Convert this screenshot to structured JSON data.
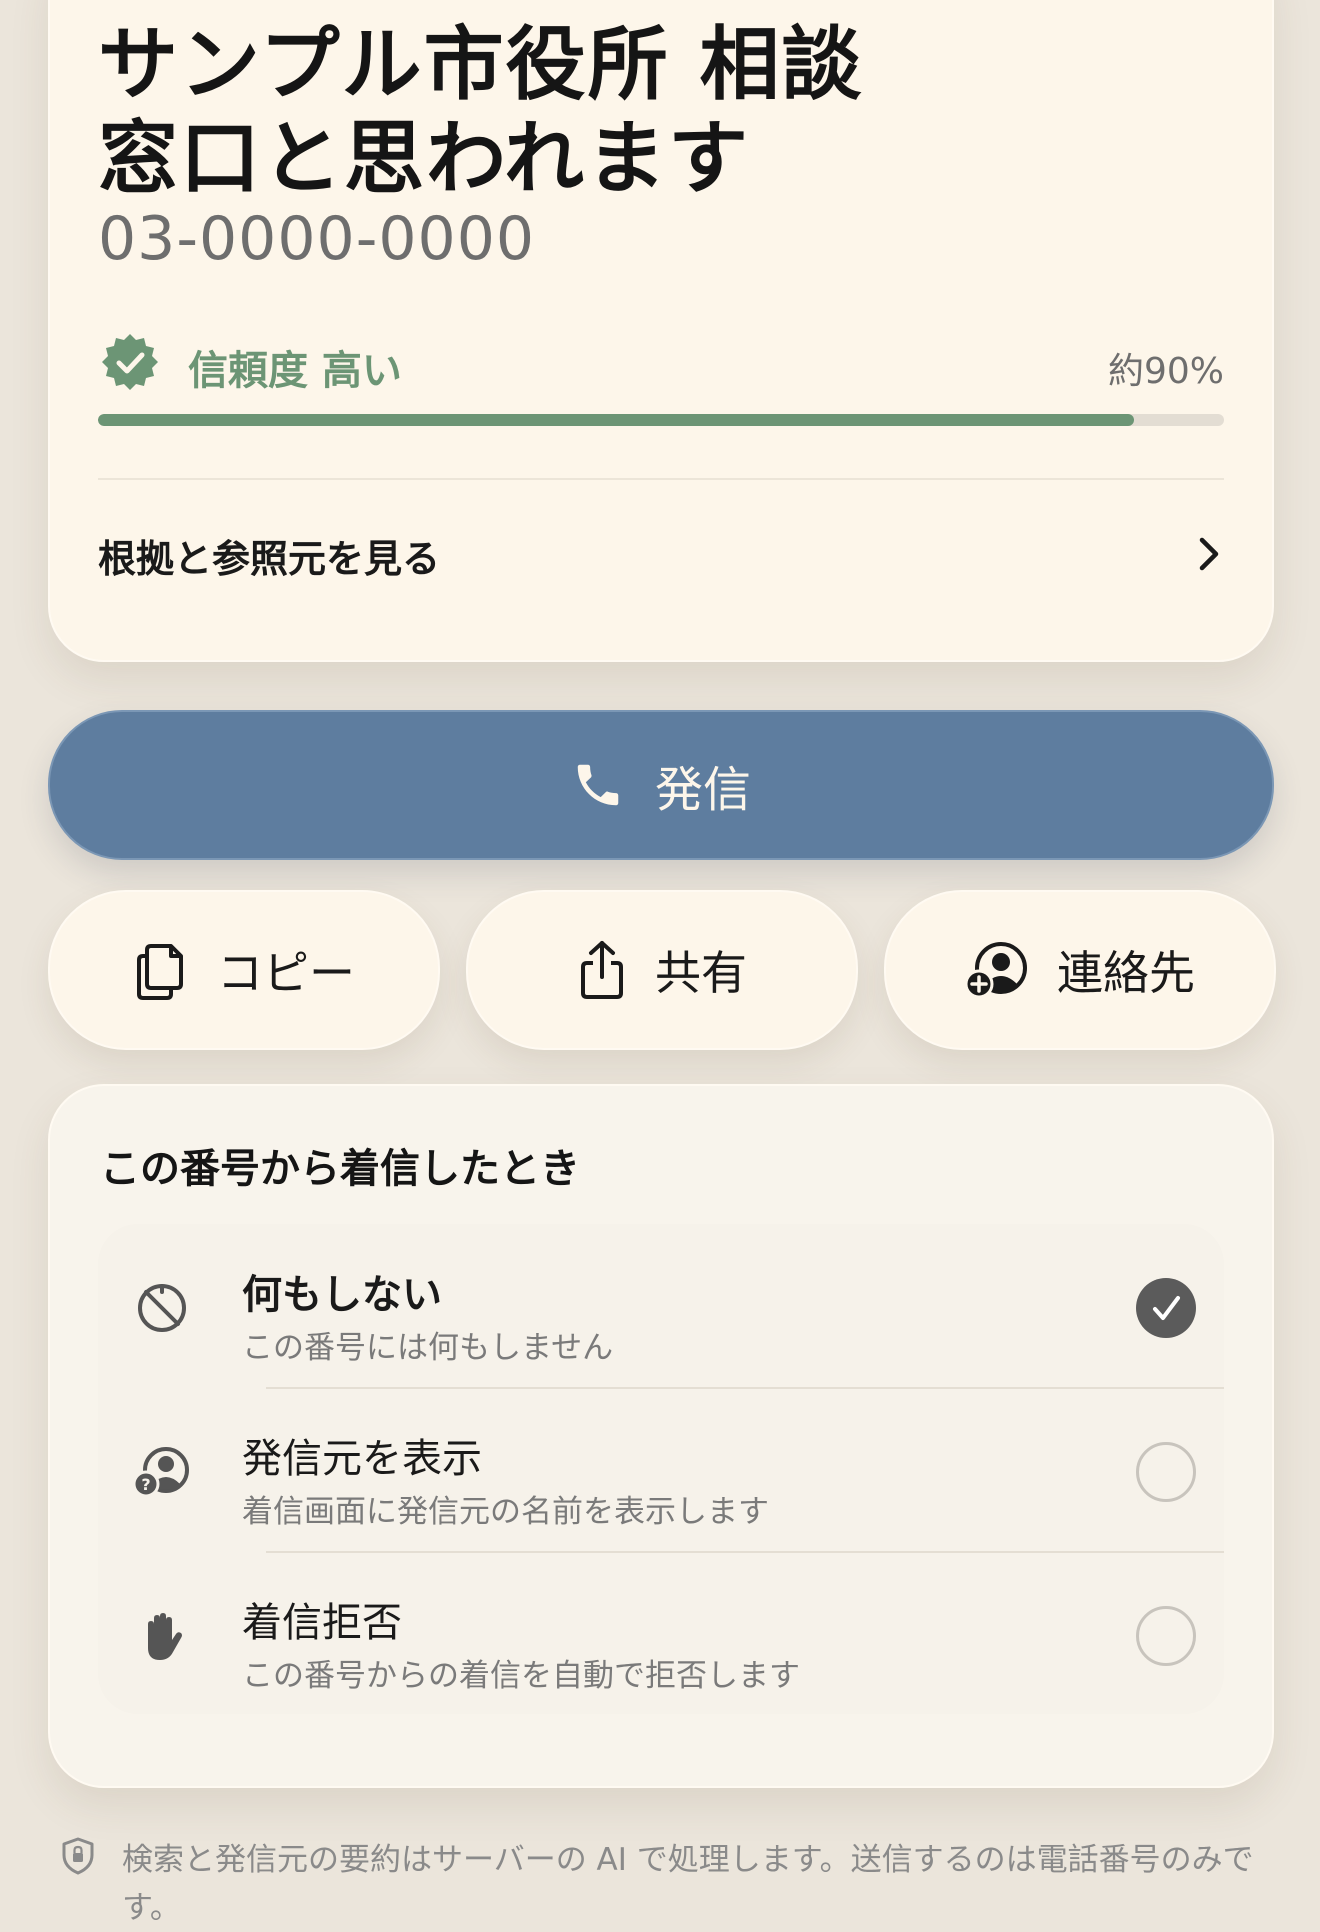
{
  "result": {
    "title_line1": "サンプル市役所 相談",
    "title_line2": "窓口と思われます",
    "phone_number": "03-0000-0000",
    "trust_label": "信頼度 高い",
    "trust_percent_label": "約90%",
    "trust_level": 0.92,
    "evidence_link": "根拠と参照元を見る"
  },
  "actions": {
    "call": "発信",
    "copy": "コピー",
    "share": "共有",
    "contact": "連絡先"
  },
  "incoming": {
    "title": "この番号から着信したとき",
    "options": [
      {
        "title": "何もしない",
        "desc": "この番号には何もしません",
        "selected": true,
        "icon": "do-not-disturb-icon"
      },
      {
        "title": "発信元を表示",
        "desc": "着信画面に発信元の名前を表示します",
        "selected": false,
        "icon": "caller-id-icon"
      },
      {
        "title": "着信拒否",
        "desc": "この番号からの着信を自動で拒否します",
        "selected": false,
        "icon": "hand-block-icon"
      }
    ]
  },
  "footer": {
    "note": "検索と発信元の要約はサーバーの AI で処理します。送信するのは電話番号のみです。"
  },
  "colors": {
    "accent_green": "#6c9575",
    "call_blue": "#5e7d9f",
    "card_bg": "#fdf6ea",
    "page_bg": "#ebe5db"
  }
}
